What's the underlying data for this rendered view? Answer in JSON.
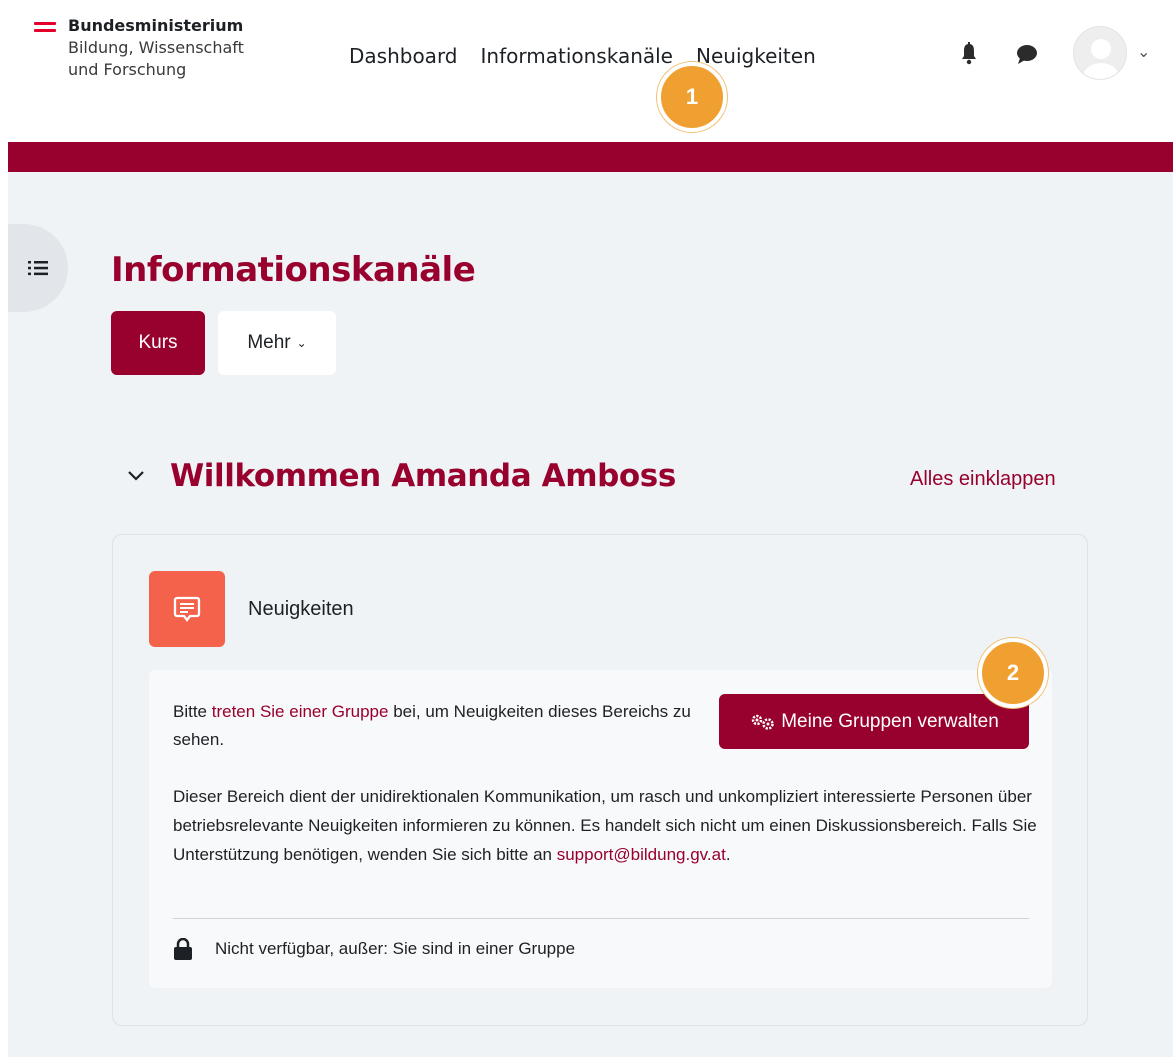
{
  "header": {
    "logo": {
      "line1": "Bundesministerium",
      "line2": "Bildung, Wissenschaft",
      "line3": "und Forschung"
    },
    "nav": [
      {
        "label": "Dashboard"
      },
      {
        "label": "Informationskanäle"
      },
      {
        "label": "Neuigkeiten"
      }
    ],
    "icons": [
      "bell-icon",
      "chat-icon",
      "user-avatar",
      "chevron-down-icon"
    ]
  },
  "callouts": {
    "one": "1",
    "two": "2"
  },
  "page": {
    "title": "Informationskanäle",
    "tabs": {
      "kurs": "Kurs",
      "mehr": "Mehr"
    }
  },
  "section": {
    "title": "Willkommen Amanda Amboss",
    "collapse_link": "Alles einklappen"
  },
  "activity": {
    "name": "Neuigkeiten",
    "restriction_prefix": "Bitte ",
    "restriction_link": "treten Sie einer Gruppe",
    "restriction_suffix": " bei, um Neuigkeiten dieses Bereichs zu sehen.",
    "manage_button": "Meine Gruppen verwalten",
    "description": "Dieser Bereich dient der unidirektionalen Kommunikation, um rasch und unkompliziert interessierte Personen über betriebsrelevante Neuigkeiten informieren zu können. Es handelt sich nicht um einen Diskussionsbereich. Falls Sie Unterstützung benötigen, wenden Sie sich bitte an ",
    "support_email": "support@bildung.gv.at",
    "description_end": ".",
    "availability": "Nicht verfügbar, außer: Sie sind in einer Gruppe"
  },
  "colors": {
    "brand": "#98002e",
    "activity_icon": "#f4624c",
    "callout": "#f0a030",
    "background": "#f0f3f5"
  }
}
